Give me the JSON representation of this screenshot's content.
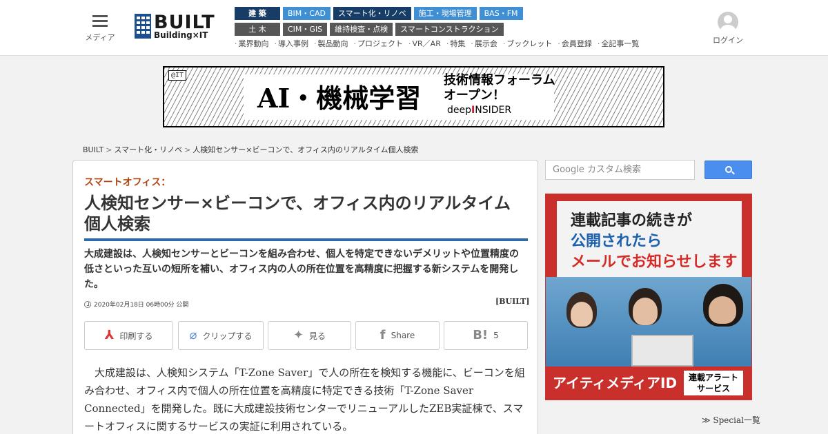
{
  "header": {
    "menu_label": "メディア",
    "logo_text": "BUILT",
    "logo_sub": "Building×IT",
    "login_label": "ログイン",
    "nav_row1": [
      "建 築",
      "BIM・CAD",
      "スマート化・リノベ",
      "施工・現場管理",
      "BAS・FM"
    ],
    "nav_row2": [
      "土 木",
      "CIM・GIS",
      "維持検査・点検",
      "スマートコンストラクション"
    ],
    "subnav": [
      "業界動向",
      "導入事例",
      "製品動向",
      "プロジェクト",
      "VR／AR",
      "特集",
      "展示会",
      "ブックレット",
      "会員登録",
      "全記事一覧"
    ]
  },
  "banner": {
    "tag": "@IT",
    "main": "AI・機械学習",
    "side_line1": "技術情報フォーラム",
    "side_line2": "オープン！",
    "brand_pre": "deep",
    "brand_mid": "I",
    "brand_post": "NSIDER"
  },
  "breadcrumb": {
    "items": [
      "BUILT",
      "スマート化・リノベ",
      "人検知センサー×ビーコンで、オフィス内のリアルタイム個人検索"
    ]
  },
  "article": {
    "kicker": "スマートオフィス：",
    "title": "人検知センサー×ビーコンで、オフィス内のリアルタイム個人検索",
    "lead": "大成建設は、人検知センサーとビーコンを組み合わせ、個人を特定できないデメリットや位置精度の低さといった互いの短所を補い、オフィス内の人の所在位置を高精度に把握する新システムを開発した。",
    "date": "2020年02月18日 06時00分 公開",
    "source": "[BUILT]",
    "actions": {
      "print": "印刷する",
      "clip": "クリップする",
      "twitter": "見る",
      "share": "Share",
      "hatena": "5"
    },
    "body": "大成建設は、人検知システム「T-Zone Saver」で人の所在を検知する機能に、ビーコンを組み合わせ、オフィス内で個人の所在位置を高精度に特定できる技術「T-Zone Saver Connected」を開発した。既に大成建設技術センターでリニューアルしたZEB実証棟で、スマートオフィスに関するサービスの実証に利用されている。"
  },
  "sidebar": {
    "search_placeholder": "Google カスタム検索",
    "ad_line1": "連載記事の続きが",
    "ad_line2": "公開されたら",
    "ad_line3": "メールでお知らせします",
    "ad_bottom": "アイティメディアID",
    "ad_tag_line1": "連載アラート",
    "ad_tag_line2": "サービス",
    "special_link": "≫ Special一覧"
  },
  "colors": {
    "nav_dark": "#173d67",
    "nav_blue": "#3f8fd2",
    "nav_grey": "#575757",
    "kicker": "#b1440e",
    "title_rule": "#2f6aa8",
    "search_button": "#4a8ff0",
    "ad_red": "#c9302c"
  }
}
